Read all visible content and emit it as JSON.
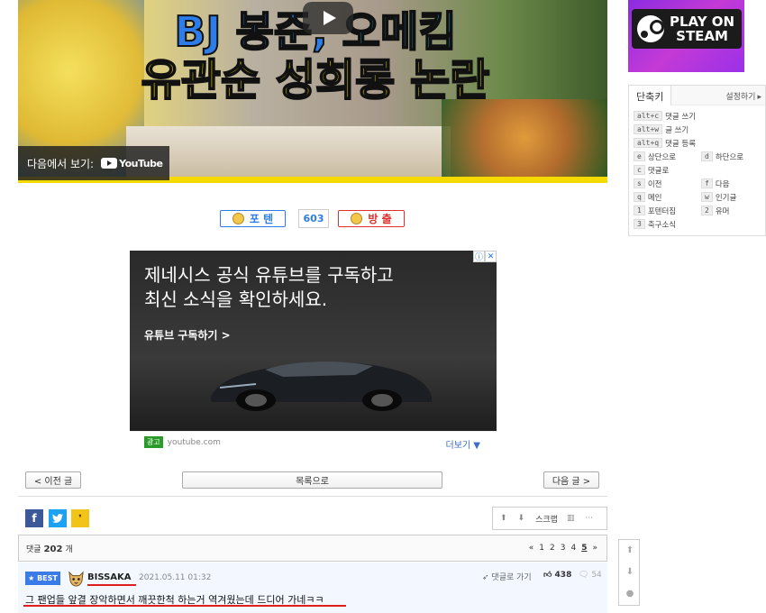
{
  "video": {
    "title_line1_prefix": "BJ 봉준, ",
    "title_line1_highlight": "오메킴",
    "title_line2": "유관순 성희롱 논란",
    "watch_on_label": "다음에서 보기:",
    "youtube_label": "YouTube"
  },
  "steam_banner": {
    "line1": "PLAY ON",
    "line2": "STEAM"
  },
  "shortcuts": {
    "title": "단축키",
    "settings": "설정하기",
    "items": [
      {
        "key": "alt+c",
        "label": "댓글 쓰기"
      },
      {
        "key": "alt+w",
        "label": "글 쓰기"
      },
      {
        "key": "alt+q",
        "label": "댓글 등록"
      },
      {
        "key": "e",
        "label": "상단으로"
      },
      {
        "key": "d",
        "label": "하단으로"
      },
      {
        "key": "c",
        "label": "댓글로"
      },
      {
        "key": "s",
        "label": "이전"
      },
      {
        "key": "f",
        "label": "다음"
      },
      {
        "key": "q",
        "label": "메인"
      },
      {
        "key": "w",
        "label": "인기글"
      },
      {
        "key": "1",
        "label": "포텐터짐"
      },
      {
        "key": "2",
        "label": "유머"
      },
      {
        "key": "3",
        "label": "축구소식"
      }
    ]
  },
  "vote": {
    "up_label": "포 텐",
    "count": "603",
    "down_label": "방 출"
  },
  "ad": {
    "headline_line1": "제네시스 공식 유튜브를 구독하고",
    "headline_line2": "최신 소식을 확인하세요.",
    "cta": "유튜브 구독하기 >",
    "label": "광고",
    "domain": "youtube.com",
    "more": "더보기 ▼"
  },
  "nav": {
    "prev": "< 이전 글",
    "list": "목록으로",
    "next": "다음 글 >"
  },
  "tools": {
    "scrap": "스크랩"
  },
  "comments": {
    "count_prefix": "댓글",
    "count": "202",
    "count_suffix": "개",
    "pages": [
      "«",
      "1",
      "2",
      "3",
      "4",
      "5",
      "»"
    ],
    "current_page": "5"
  },
  "best_comment": {
    "badge": "★ BEST",
    "username": "BISSAKA",
    "date": "2021.05.11 01:32",
    "reply_link": "댓글로 가기",
    "likes": "438",
    "replies": "54",
    "text": "그 팬업들 앞결 장악하면서 깨끗한척 하는거 역겨웠는데 드디어 가네ㅋㅋ"
  }
}
